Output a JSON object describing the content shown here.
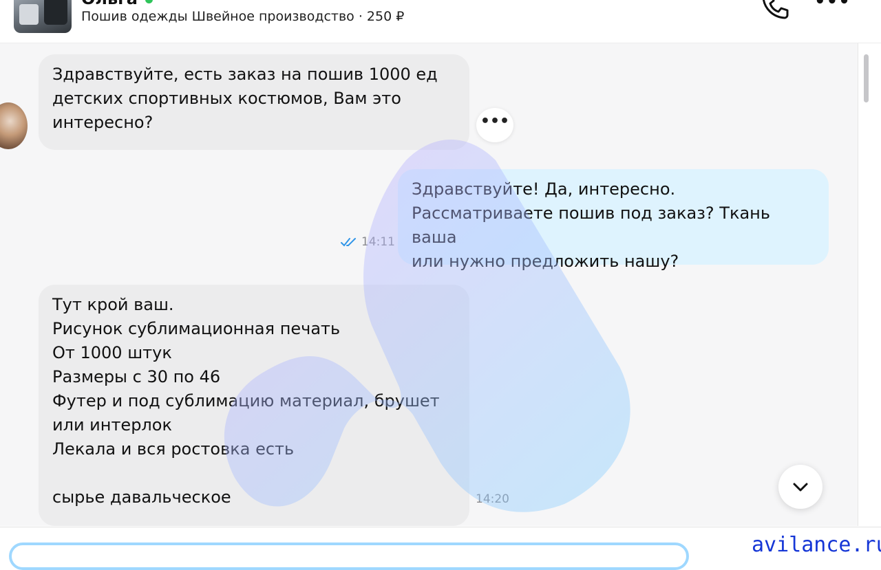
{
  "header": {
    "contact_name": "Ольга",
    "subtitle": "Пошив одежды Швейное производство · 250 ₽",
    "status": "online"
  },
  "messages": [
    {
      "direction": "incoming",
      "text": "Здравствуйте, есть заказ на пошив 1000 ед\nдетских спортивных костюмов, Вам это\nинтересно?",
      "time": ""
    },
    {
      "direction": "outgoing",
      "text": "Здравствуйте! Да, интересно.\nРассматриваете пошив под заказ? Ткань ваша\nили нужно предложить нашу?",
      "time": "14:11",
      "read": true
    },
    {
      "direction": "incoming",
      "text": "Тут крой ваш.\nРисунок сублимационная печать\nОт 1000 штук\nРазмеры с 30 по 46\nФутер и под сублимацию материал, брушет\nили интерлок\n Лекала и вся ростовка есть\n\n сырье давальческое",
      "time": "14:20"
    }
  ],
  "bubble_menu_label": "•••",
  "header_more_label": "•••",
  "footer": {
    "site_label": "avilance.ru"
  },
  "colors": {
    "incoming_bubble": "#ececed",
    "outgoing_bubble": "#def3fe",
    "input_border": "#9fd8ff",
    "online": "#2fc45a",
    "read_check": "#2f95e8",
    "site_label": "#1536d6"
  },
  "icons": [
    "phone-icon",
    "more-icon",
    "double-check-icon",
    "chevron-down-icon"
  ]
}
